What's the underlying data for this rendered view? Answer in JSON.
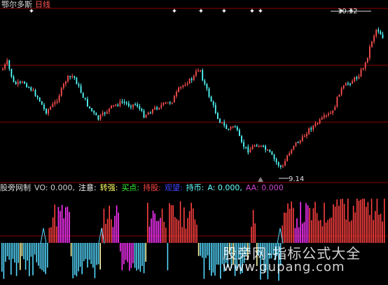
{
  "header": {
    "stock_name": "鄂尔多斯",
    "period": "日线"
  },
  "price_labels": {
    "high": "10.32",
    "low": "9.14"
  },
  "indicator_bar": {
    "name": "股旁网制",
    "items": [
      {
        "text": "VO: 0.000,",
        "color": "#cfcfcf"
      },
      {
        "text": "注意:",
        "color": "#ffffff"
      },
      {
        "text": "转强:",
        "color": "#ffff66"
      },
      {
        "text": "买点:",
        "color": "#33ff33"
      },
      {
        "text": "持股:",
        "color": "#ff4444"
      },
      {
        "text": "观望:",
        "color": "#4444ff"
      },
      {
        "text": "持币:",
        "color": "#66ffff"
      },
      {
        "text": "A: 0.000,",
        "color": "#66ffff"
      },
      {
        "text": "AA: 0.000",
        "color": "#cc44cc"
      }
    ],
    "name_color": "#dcdcdc"
  },
  "watermark": {
    "title": "股旁网-指标公式大全",
    "url": "www.gupang.com"
  },
  "colors": {
    "background": "#000000",
    "up_candle": "#ff5050",
    "down_candle": "#54ffff",
    "grid": "#8b0000",
    "marker": "#ffffff",
    "magenta": "#ff33ff",
    "yellow_bar": "#ffffaa",
    "red_bar": "#ff4040",
    "cyan_bar": "#54d8ff"
  }
}
